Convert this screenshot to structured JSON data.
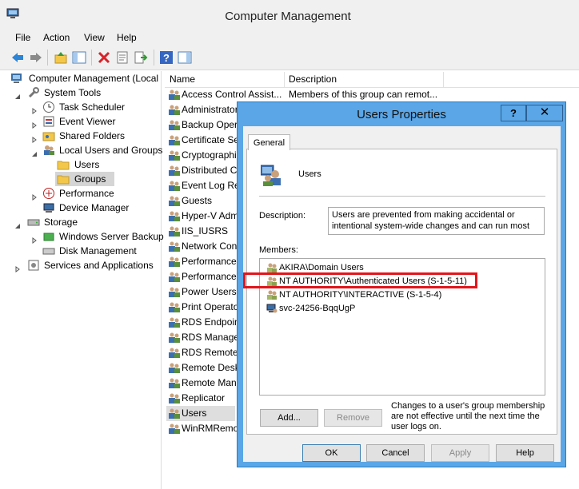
{
  "window": {
    "title": "Computer Management",
    "menu": [
      "File",
      "Action",
      "View",
      "Help"
    ]
  },
  "toolbar_icons": [
    "back-arrow-icon",
    "forward-arrow-icon",
    "up-folder-icon",
    "show-hide-tree-icon",
    "delete-icon",
    "properties-icon",
    "export-list-icon",
    "help-icon",
    "action-pane-icon"
  ],
  "tree": {
    "items": [
      {
        "label": "Computer Management (Local",
        "icon": "computer-mgmt-icon"
      },
      {
        "label": "System Tools",
        "icon": "tools-icon"
      },
      {
        "label": "Task Scheduler",
        "icon": "clock-icon"
      },
      {
        "label": "Event Viewer",
        "icon": "event-viewer-icon"
      },
      {
        "label": "Shared Folders",
        "icon": "shared-folder-icon"
      },
      {
        "label": "Local Users and Groups",
        "icon": "users-icon"
      },
      {
        "label": "Users",
        "icon": "folder-icon"
      },
      {
        "label": "Groups",
        "icon": "folder-icon"
      },
      {
        "label": "Performance",
        "icon": "performance-icon"
      },
      {
        "label": "Device Manager",
        "icon": "device-manager-icon"
      },
      {
        "label": "Storage",
        "icon": "storage-icon"
      },
      {
        "label": "Windows Server Backup",
        "icon": "backup-icon"
      },
      {
        "label": "Disk Management",
        "icon": "disk-icon"
      },
      {
        "label": "Services and Applications",
        "icon": "services-icon"
      }
    ]
  },
  "list": {
    "columns": [
      "Name",
      "Description"
    ],
    "rows": [
      {
        "name": "Access Control Assist...",
        "description": "Members of this group can remot..."
      },
      {
        "name": "Administrators",
        "description": ""
      },
      {
        "name": "Backup Operators",
        "description": ""
      },
      {
        "name": "Certificate Service DCOM Access",
        "description": ""
      },
      {
        "name": "Cryptographic Operators",
        "description": ""
      },
      {
        "name": "Distributed COM Users",
        "description": ""
      },
      {
        "name": "Event Log Readers",
        "description": ""
      },
      {
        "name": "Guests",
        "description": ""
      },
      {
        "name": "Hyper-V Administrators",
        "description": ""
      },
      {
        "name": "IIS_IUSRS",
        "description": ""
      },
      {
        "name": "Network Configuration Operators",
        "description": ""
      },
      {
        "name": "Performance Log Users",
        "description": ""
      },
      {
        "name": "Performance Monitor Users",
        "description": ""
      },
      {
        "name": "Power Users",
        "description": ""
      },
      {
        "name": "Print Operators",
        "description": ""
      },
      {
        "name": "RDS Endpoint Servers",
        "description": ""
      },
      {
        "name": "RDS Management Servers",
        "description": ""
      },
      {
        "name": "RDS Remote Access Servers",
        "description": ""
      },
      {
        "name": "Remote Desktop Users",
        "description": ""
      },
      {
        "name": "Remote Management Users",
        "description": ""
      },
      {
        "name": "Replicator",
        "description": ""
      },
      {
        "name": "Users",
        "description": ""
      },
      {
        "name": "WinRMRemoteWMIUsers__",
        "description": ""
      }
    ]
  },
  "dialog": {
    "title": "Users Properties",
    "help_btn": "?",
    "close_btn": "✕",
    "tab": "General",
    "group_name": "Users",
    "description_label": "Description:",
    "description_value": "Users are prevented from making accidental or intentional system-wide changes and can run most",
    "members_label": "Members:",
    "members": [
      {
        "name": "AKIRA\\Domain Users"
      },
      {
        "name": "NT AUTHORITY\\Authenticated Users (S-1-5-11)"
      },
      {
        "name": "NT AUTHORITY\\INTERACTIVE (S-1-5-4)"
      },
      {
        "name": "svc-24256-BqqUgP"
      }
    ],
    "add_btn": "Add...",
    "remove_btn": "Remove",
    "note": "Changes to a user's group membership are not effective until the next time the user logs on.",
    "ok_btn": "OK",
    "cancel_btn": "Cancel",
    "apply_btn": "Apply",
    "help_text_btn": "Help"
  },
  "colors": {
    "dialog_frame": "#5aa6e6",
    "highlight_box": "#e3151b"
  }
}
